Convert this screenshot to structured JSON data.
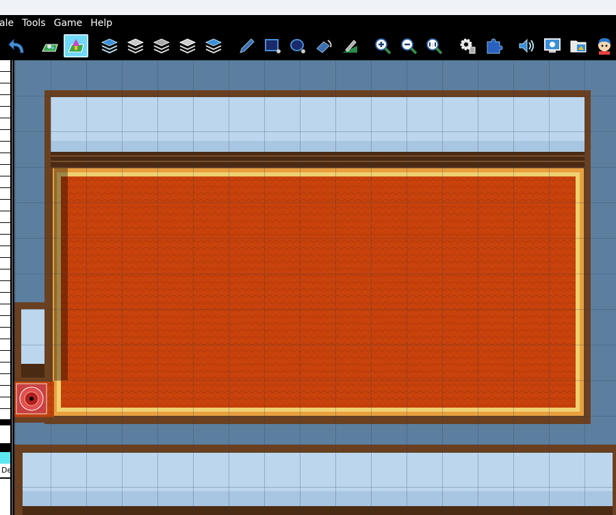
{
  "menu": {
    "items": [
      "ale",
      "Tools",
      "Game",
      "Help"
    ]
  },
  "toolbar": {
    "buttons": [
      {
        "name": "undo-icon"
      },
      {
        "name": "map-mode-icon"
      },
      {
        "name": "event-mode-icon",
        "active": true
      },
      {
        "name": "layer-1-icon"
      },
      {
        "name": "layer-2-icon"
      },
      {
        "name": "layer-3-icon"
      },
      {
        "name": "layer-4-icon"
      },
      {
        "name": "layer-5-icon"
      },
      {
        "name": "pencil-icon"
      },
      {
        "name": "rectangle-icon"
      },
      {
        "name": "ellipse-icon"
      },
      {
        "name": "fill-icon"
      },
      {
        "name": "shadow-pen-icon"
      },
      {
        "name": "zoom-in-icon"
      },
      {
        "name": "zoom-out-icon"
      },
      {
        "name": "zoom-actual-icon"
      },
      {
        "name": "database-icon"
      },
      {
        "name": "plugin-manager-icon"
      },
      {
        "name": "sound-test-icon"
      },
      {
        "name": "event-searcher-icon"
      },
      {
        "name": "resource-manager-icon"
      },
      {
        "name": "character-generator-icon"
      }
    ]
  },
  "left_panel": {
    "tab_label": "De"
  },
  "map": {
    "colors": {
      "void": "#5c7fa0",
      "wall": "#bcd6ee",
      "wall_dark": "#a8c6e2",
      "wood": "#6a4020",
      "carpet": "#c8420c",
      "carpet_border": "#e8a040",
      "grid": "#2a3848"
    },
    "event": {
      "name": "magic-circle-event"
    }
  }
}
